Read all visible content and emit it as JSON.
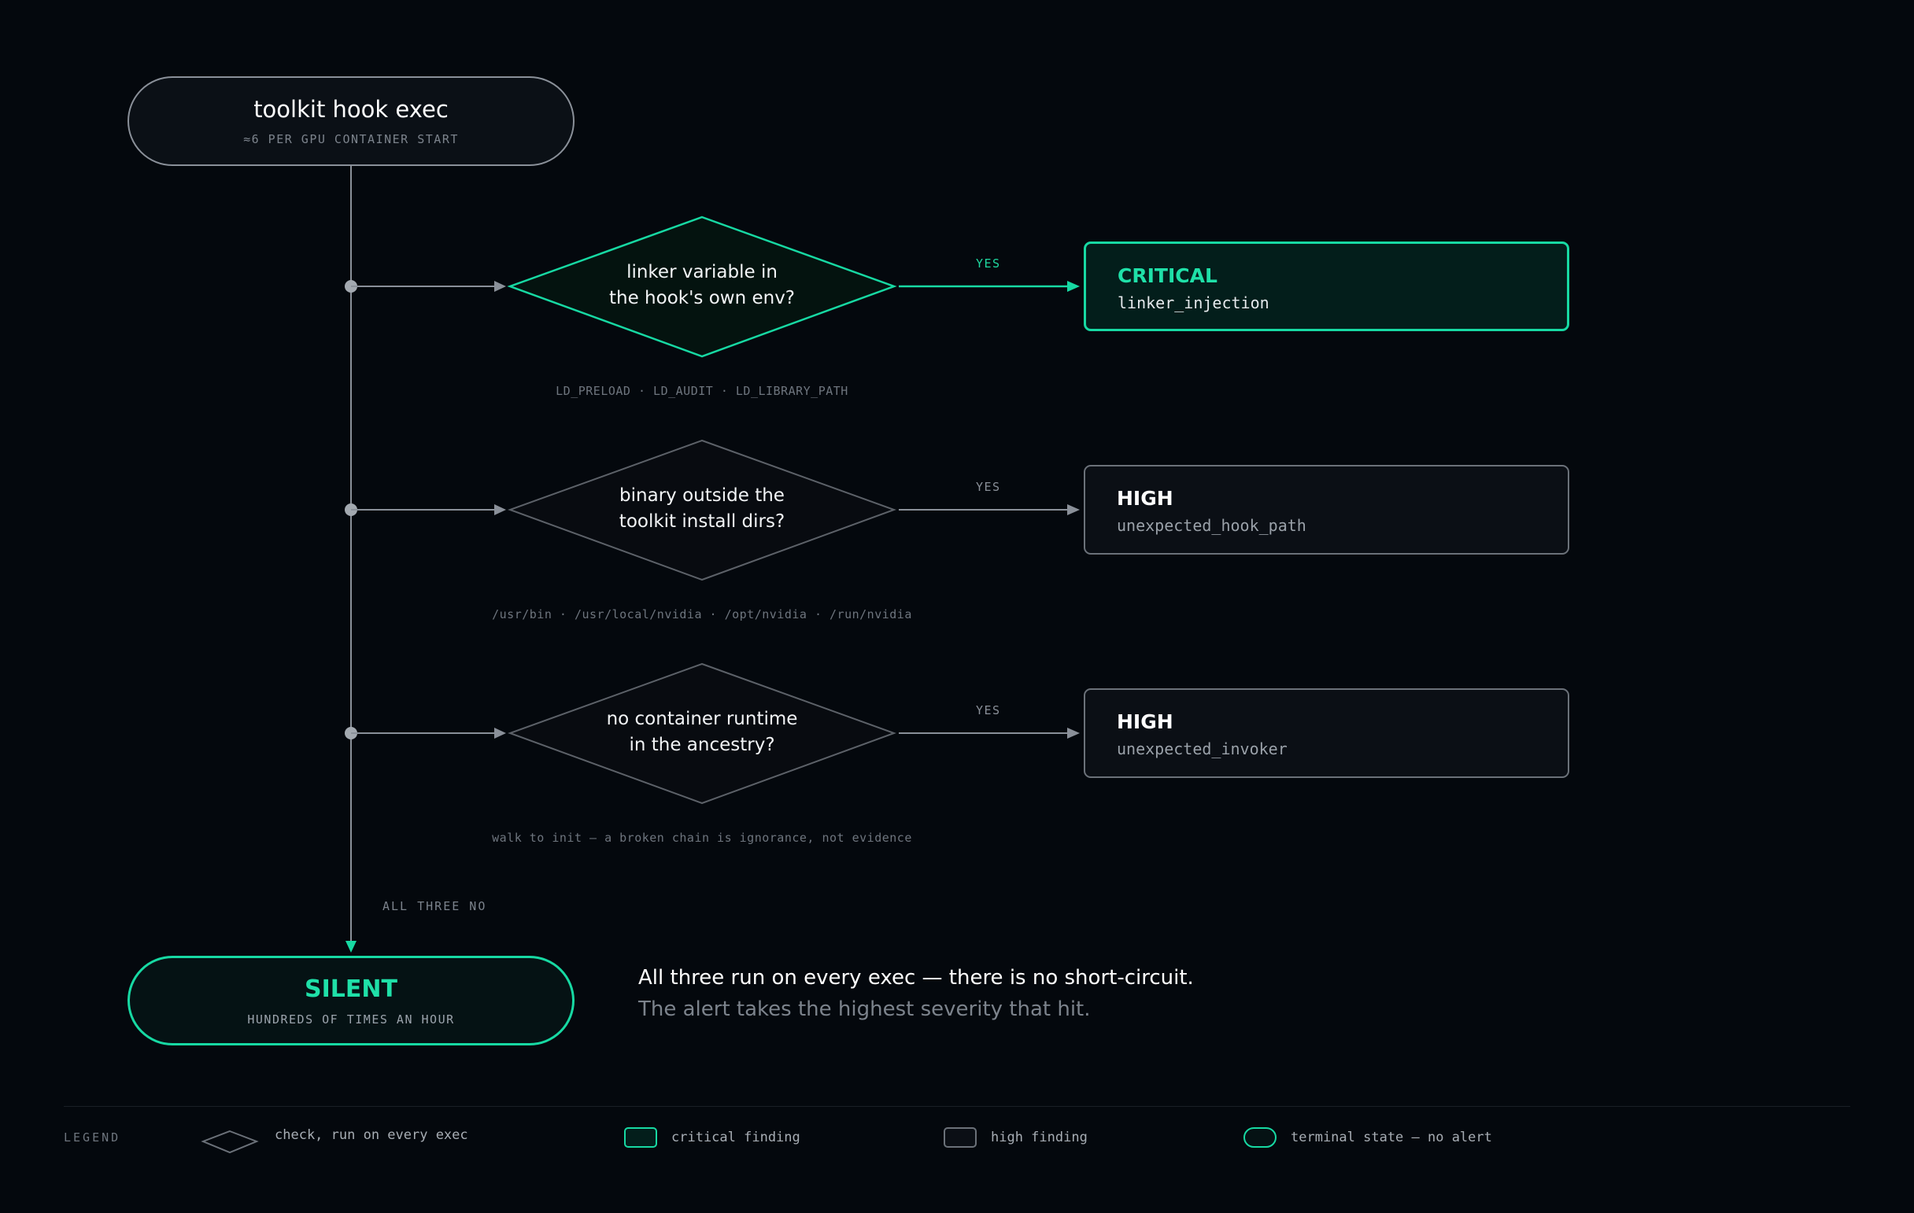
{
  "colors": {
    "background": "#04080d",
    "accent": "#17d9a3",
    "neutral_line": "#8a9099",
    "diamond_neutral": "#5c6168"
  },
  "start": {
    "title": "toolkit hook exec",
    "subtitle": "≈6 PER GPU CONTAINER START"
  },
  "checks": [
    {
      "question_line1": "linker variable in",
      "question_line2": "the hook's own env?",
      "note": "LD_PRELOAD · LD_AUDIT · LD_LIBRARY_PATH",
      "yes_label": "YES",
      "severity": "CRITICAL",
      "rule": "linker_injection"
    },
    {
      "question_line1": "binary outside the",
      "question_line2": "toolkit install dirs?",
      "note": "/usr/bin · /usr/local/nvidia · /opt/nvidia · /run/nvidia",
      "yes_label": "YES",
      "severity": "HIGH",
      "rule": "unexpected_hook_path"
    },
    {
      "question_line1": "no container runtime",
      "question_line2": "in the ancestry?",
      "note": "walk to init — a broken chain is ignorance, not evidence",
      "yes_label": "YES",
      "severity": "HIGH",
      "rule": "unexpected_invoker"
    }
  ],
  "all_no_label": "ALL THREE NO",
  "end": {
    "title": "SILENT",
    "subtitle": "HUNDREDS OF TIMES AN HOUR"
  },
  "summary": {
    "line1": "All three run on every exec — there is no short-circuit.",
    "line2": "The alert takes the highest severity that hit."
  },
  "legend": {
    "title": "LEGEND",
    "items": [
      {
        "icon": "diamond",
        "label": "check, run on every exec"
      },
      {
        "icon": "critical-box",
        "label": "critical finding"
      },
      {
        "icon": "high-box",
        "label": "high finding"
      },
      {
        "icon": "terminal-pill",
        "label": "terminal state — no alert"
      }
    ]
  }
}
